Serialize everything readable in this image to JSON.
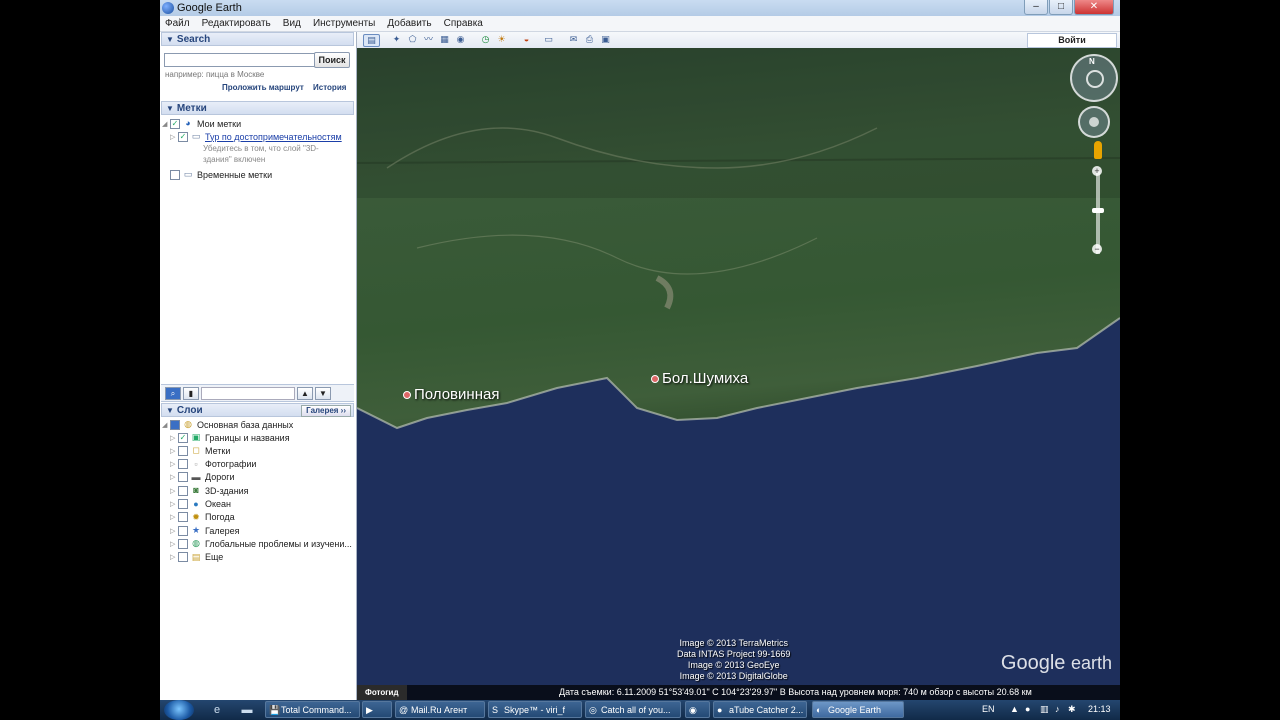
{
  "window": {
    "title": "Google Earth",
    "minimize": "–",
    "maximize": "□",
    "close": "✕"
  },
  "menu": [
    "Файл",
    "Редактировать",
    "Вид",
    "Инструменты",
    "Добавить",
    "Справка"
  ],
  "search": {
    "header": "Search",
    "input_value": "",
    "button": "Поиск",
    "hint": "например: пицца в Москве",
    "route_link": "Проложить маршрут",
    "history_link": "История"
  },
  "places": {
    "header": "Метки",
    "my_places": "Мои метки",
    "tour": "Тур по достопримечательностям",
    "tour_note_1": "Убедитесь в том, что слой \"3D-",
    "tour_note_2": "здания\" включен",
    "temporary": "Временные метки"
  },
  "layers": {
    "header": "Слои",
    "gallery_button": "Галерея ››",
    "primary_db": "Основная база данных",
    "items": [
      {
        "label": "Границы и названия",
        "checked": true,
        "icon": "borders-icon"
      },
      {
        "label": "Метки",
        "checked": false,
        "icon": "placemark-icon"
      },
      {
        "label": "Фотографии",
        "checked": false,
        "icon": "photo-icon"
      },
      {
        "label": "Дороги",
        "checked": false,
        "icon": "road-icon"
      },
      {
        "label": "3D-здания",
        "checked": false,
        "icon": "building-icon"
      },
      {
        "label": "Океан",
        "checked": false,
        "icon": "ocean-icon"
      },
      {
        "label": "Погода",
        "checked": false,
        "icon": "weather-icon"
      },
      {
        "label": "Галерея",
        "checked": false,
        "icon": "star-icon"
      },
      {
        "label": "Глобальные проблемы и изучени...",
        "checked": false,
        "icon": "globe-icon"
      },
      {
        "label": "Еще",
        "checked": false,
        "icon": "more-icon"
      }
    ]
  },
  "toolbar": {
    "signin": "Войти"
  },
  "map": {
    "placemarks": [
      {
        "label": "Половинная"
      },
      {
        "label": "Бол.Шумиха"
      }
    ],
    "attribution": [
      "Image © 2013 TerraMetrics",
      "Data INTAS Project 99-1669",
      "Image © 2013 GeoEye",
      "Image © 2013 DigitalGlobe"
    ],
    "logo_google": "Google",
    "logo_earth": "earth",
    "nav_north": "N"
  },
  "status": {
    "tour_guide": "Фотогид",
    "text": "Дата съемки: 6.11.2009   51°53'49.01\" С  104°23'29.97\" В  Высота над уровнем моря:   740 м     обзор с высоты  20.68 км"
  },
  "taskbar": {
    "tasks": [
      {
        "label": "Total Command...",
        "icon": "💾"
      },
      {
        "label": "",
        "icon": "▶"
      },
      {
        "label": "Mail.Ru Агент",
        "icon": "@"
      },
      {
        "label": "Skype™ - viri_f",
        "icon": "S"
      },
      {
        "label": "Catch all of you...",
        "icon": "◎"
      },
      {
        "label": "",
        "icon": "◉"
      },
      {
        "label": "aTube Catcher 2...",
        "icon": "●"
      },
      {
        "label": "Google Earth",
        "icon": "◐"
      }
    ],
    "lang": "EN",
    "time": "21:13"
  },
  "colors": {
    "accent": "#26457c",
    "link": "#1b3fa8"
  }
}
